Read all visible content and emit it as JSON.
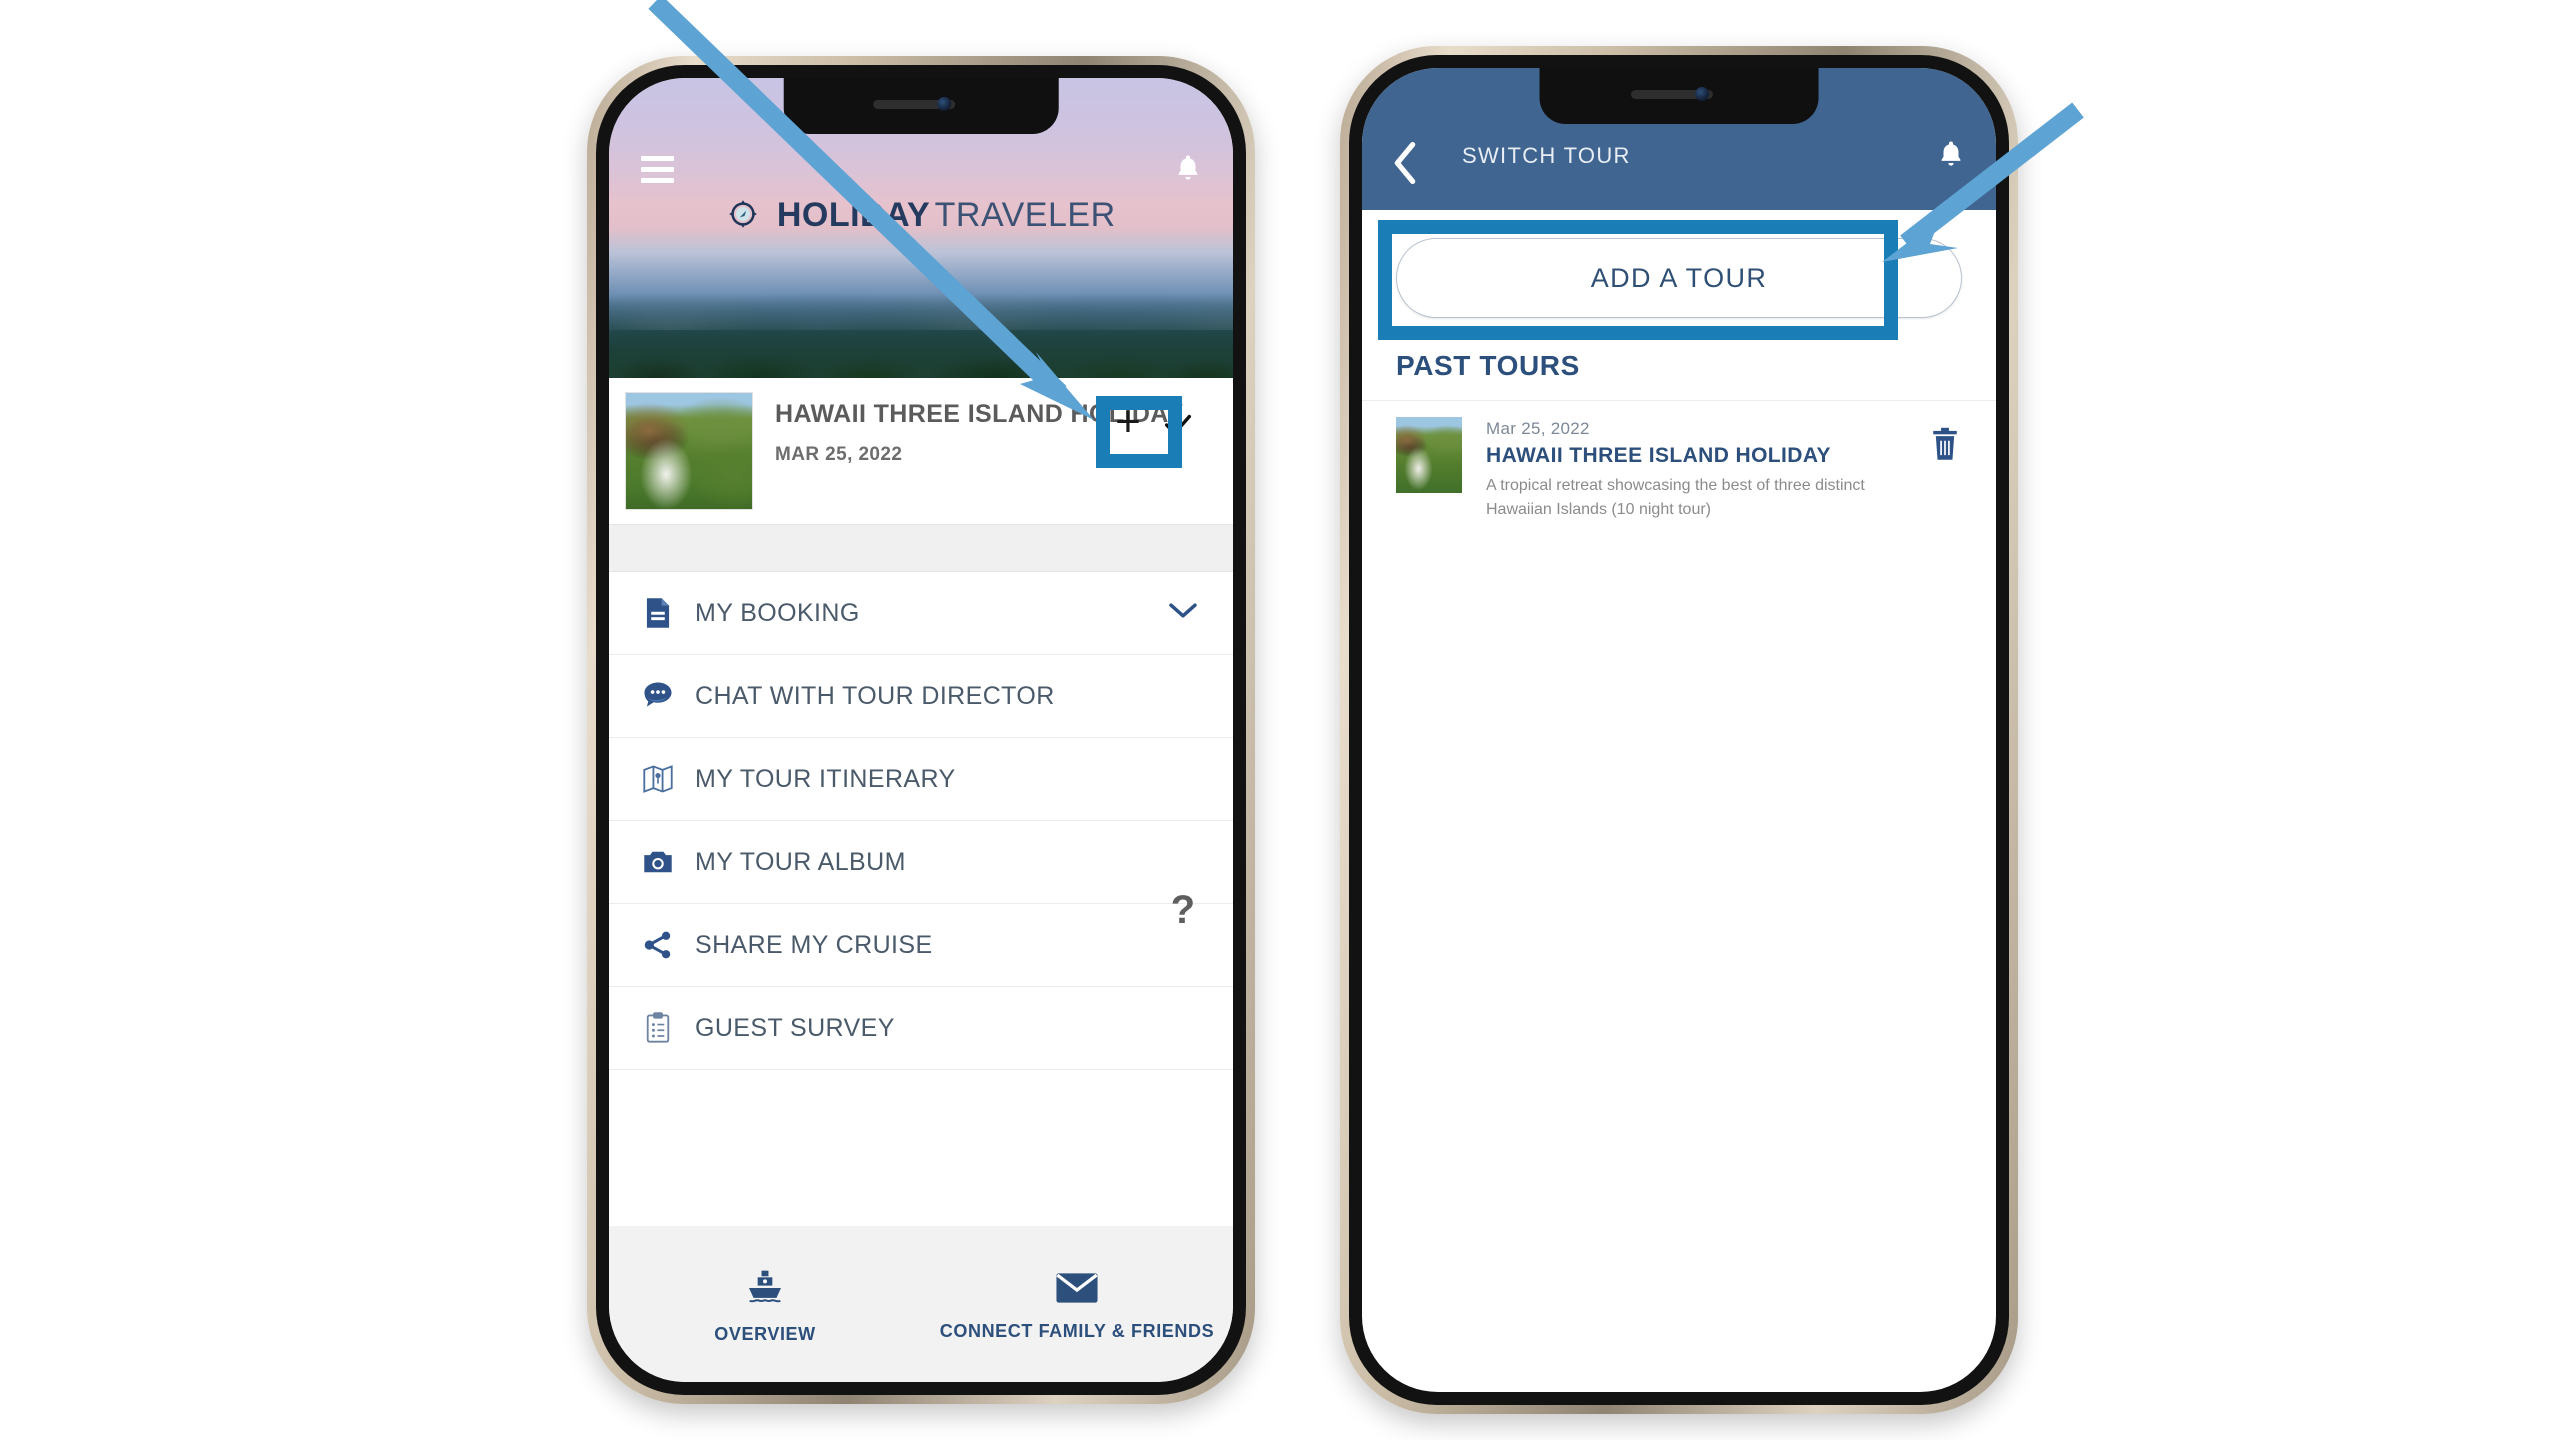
{
  "accent": {
    "highlight_blue": "#1a7db5",
    "arrow_blue": "#5da3d4",
    "brand_navy": "#2c4f7c",
    "header_blue": "#3f6590"
  },
  "phone1": {
    "name": "holiday-traveler-overview-screen",
    "header": {
      "menu_icon": "hamburger-icon",
      "bell_icon": "bell-icon",
      "brand_bold": "HOLIDAY",
      "brand_light": "TRAVELER",
      "logo_icon": "compass-icon"
    },
    "tour_card": {
      "thumbnail_icon": "tour-thumbnail-image",
      "title": "HAWAII THREE ISLAND HOLIDAY",
      "date": "MAR 25, 2022",
      "add_icon": "plus-icon",
      "selected_icon": "check-icon"
    },
    "menu_items": [
      {
        "label": "MY BOOKING",
        "icon": "booking-document-icon",
        "trailing": "chevron-down-icon"
      },
      {
        "label": "CHAT WITH TOUR DIRECTOR",
        "icon": "chat-bubble-icon",
        "trailing": ""
      },
      {
        "label": "MY TOUR ITINERARY",
        "icon": "map-icon",
        "trailing": ""
      },
      {
        "label": "MY TOUR ALBUM",
        "icon": "camera-icon",
        "trailing": ""
      },
      {
        "label": "SHARE MY CRUISE",
        "icon": "share-icon",
        "trailing": "question-mark-icon"
      },
      {
        "label": "GUEST SURVEY",
        "icon": "clipboard-icon",
        "trailing": ""
      }
    ],
    "help_badge": "?",
    "bottom_nav": [
      {
        "label": "OVERVIEW",
        "icon": "ship-icon"
      },
      {
        "label": "CONNECT FAMILY & FRIENDS",
        "icon": "envelope-icon"
      }
    ]
  },
  "phone2": {
    "name": "switch-tour-screen",
    "header": {
      "back_icon": "back-chevron-icon",
      "title": "SWITCH TOUR",
      "bell_icon": "bell-icon"
    },
    "add_tour_button": "ADD A TOUR",
    "past_tours_heading": "PAST TOURS",
    "past_tours": [
      {
        "date": "Mar 25, 2022",
        "title": "HAWAII THREE ISLAND HOLIDAY",
        "description": "A tropical retreat showcasing the best of three distinct Hawaiian Islands (10 night tour)",
        "thumbnail_icon": "tour-thumbnail-image",
        "delete_icon": "trash-icon"
      }
    ]
  },
  "annotations": {
    "highlight_plus": "plus-button-highlight-box",
    "highlight_add_tour": "add-a-tour-highlight-box",
    "arrow_1": "callout-arrow-to-plus-button",
    "arrow_2": "callout-arrow-to-add-a-tour-button"
  }
}
